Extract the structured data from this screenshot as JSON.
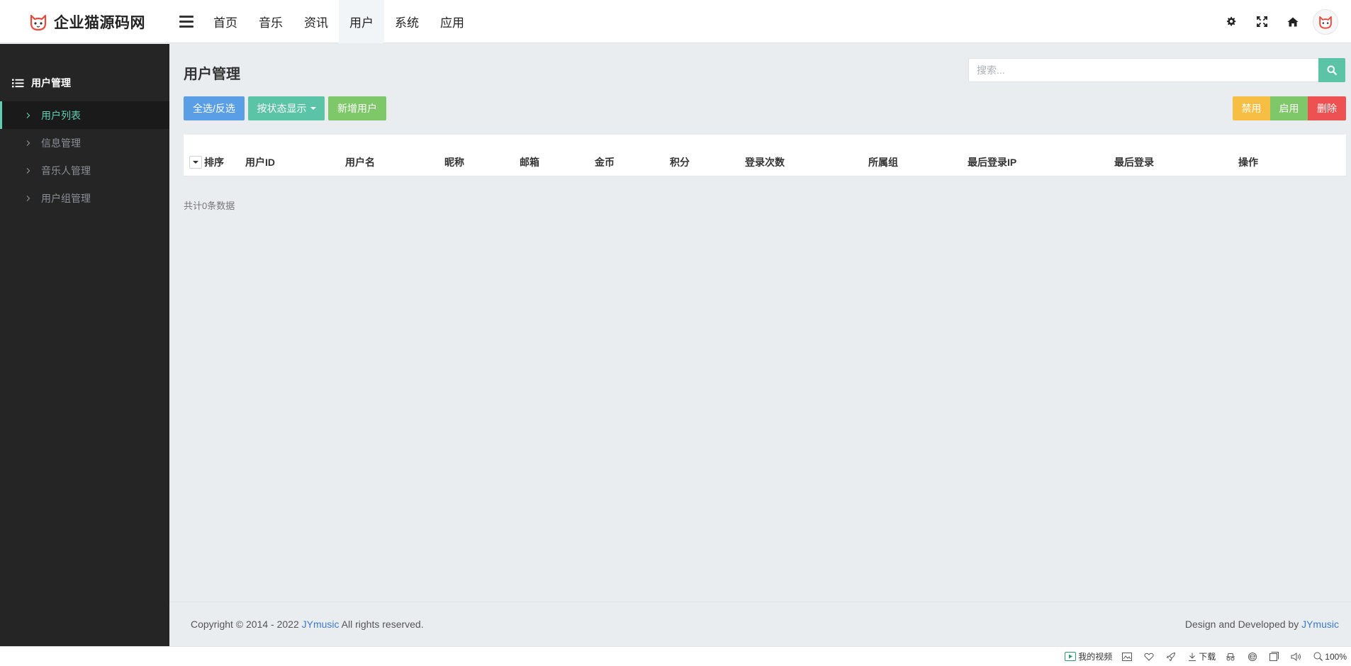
{
  "brand": {
    "name": "企业猫源码网",
    "accent": "#e8493b"
  },
  "topnav": [
    {
      "label": "首页",
      "active": false
    },
    {
      "label": "音乐",
      "active": false
    },
    {
      "label": "资讯",
      "active": false
    },
    {
      "label": "用户",
      "active": true
    },
    {
      "label": "系统",
      "active": false
    },
    {
      "label": "应用",
      "active": false
    }
  ],
  "header_icons": [
    "gear-icon",
    "fullscreen-icon",
    "home-icon",
    "avatar"
  ],
  "sidebar": {
    "title": "用户管理",
    "items": [
      {
        "label": "用户列表",
        "active": true
      },
      {
        "label": "信息管理",
        "active": false
      },
      {
        "label": "音乐人管理",
        "active": false
      },
      {
        "label": "用户组管理",
        "active": false
      }
    ]
  },
  "main": {
    "title": "用户管理",
    "search": {
      "placeholder": "搜索...",
      "value": ""
    },
    "buttons": {
      "select_all": "全选/反选",
      "filter_status": "按状态显示",
      "add_user": "新增用户",
      "disable": "禁用",
      "enable": "启用",
      "delete": "删除"
    },
    "table": {
      "sort_label": "排序",
      "columns": [
        "用户ID",
        "用户名",
        "昵称",
        "邮箱",
        "金币",
        "积分",
        "登录次数",
        "所属组",
        "最后登录IP",
        "最后登录",
        "操作"
      ],
      "rows": []
    },
    "total_text": "共计0条数据"
  },
  "footer": {
    "copyright": "Copyright © 2014 - 2022",
    "brand_link": "JYmusic",
    "rights": "All rights reserved.",
    "designed_by": "Design and Developed by",
    "designer_link": "JYmusic"
  },
  "statusbar": {
    "my_video": "我的视频",
    "download": "下载",
    "zoom": "100%"
  },
  "colors": {
    "primary_green": "#5cc4a6",
    "blue": "#5a9fe6",
    "light_green": "#7fc86a",
    "yellow": "#f7be44",
    "red": "#ee5151",
    "sidebar_bg": "#252525"
  }
}
